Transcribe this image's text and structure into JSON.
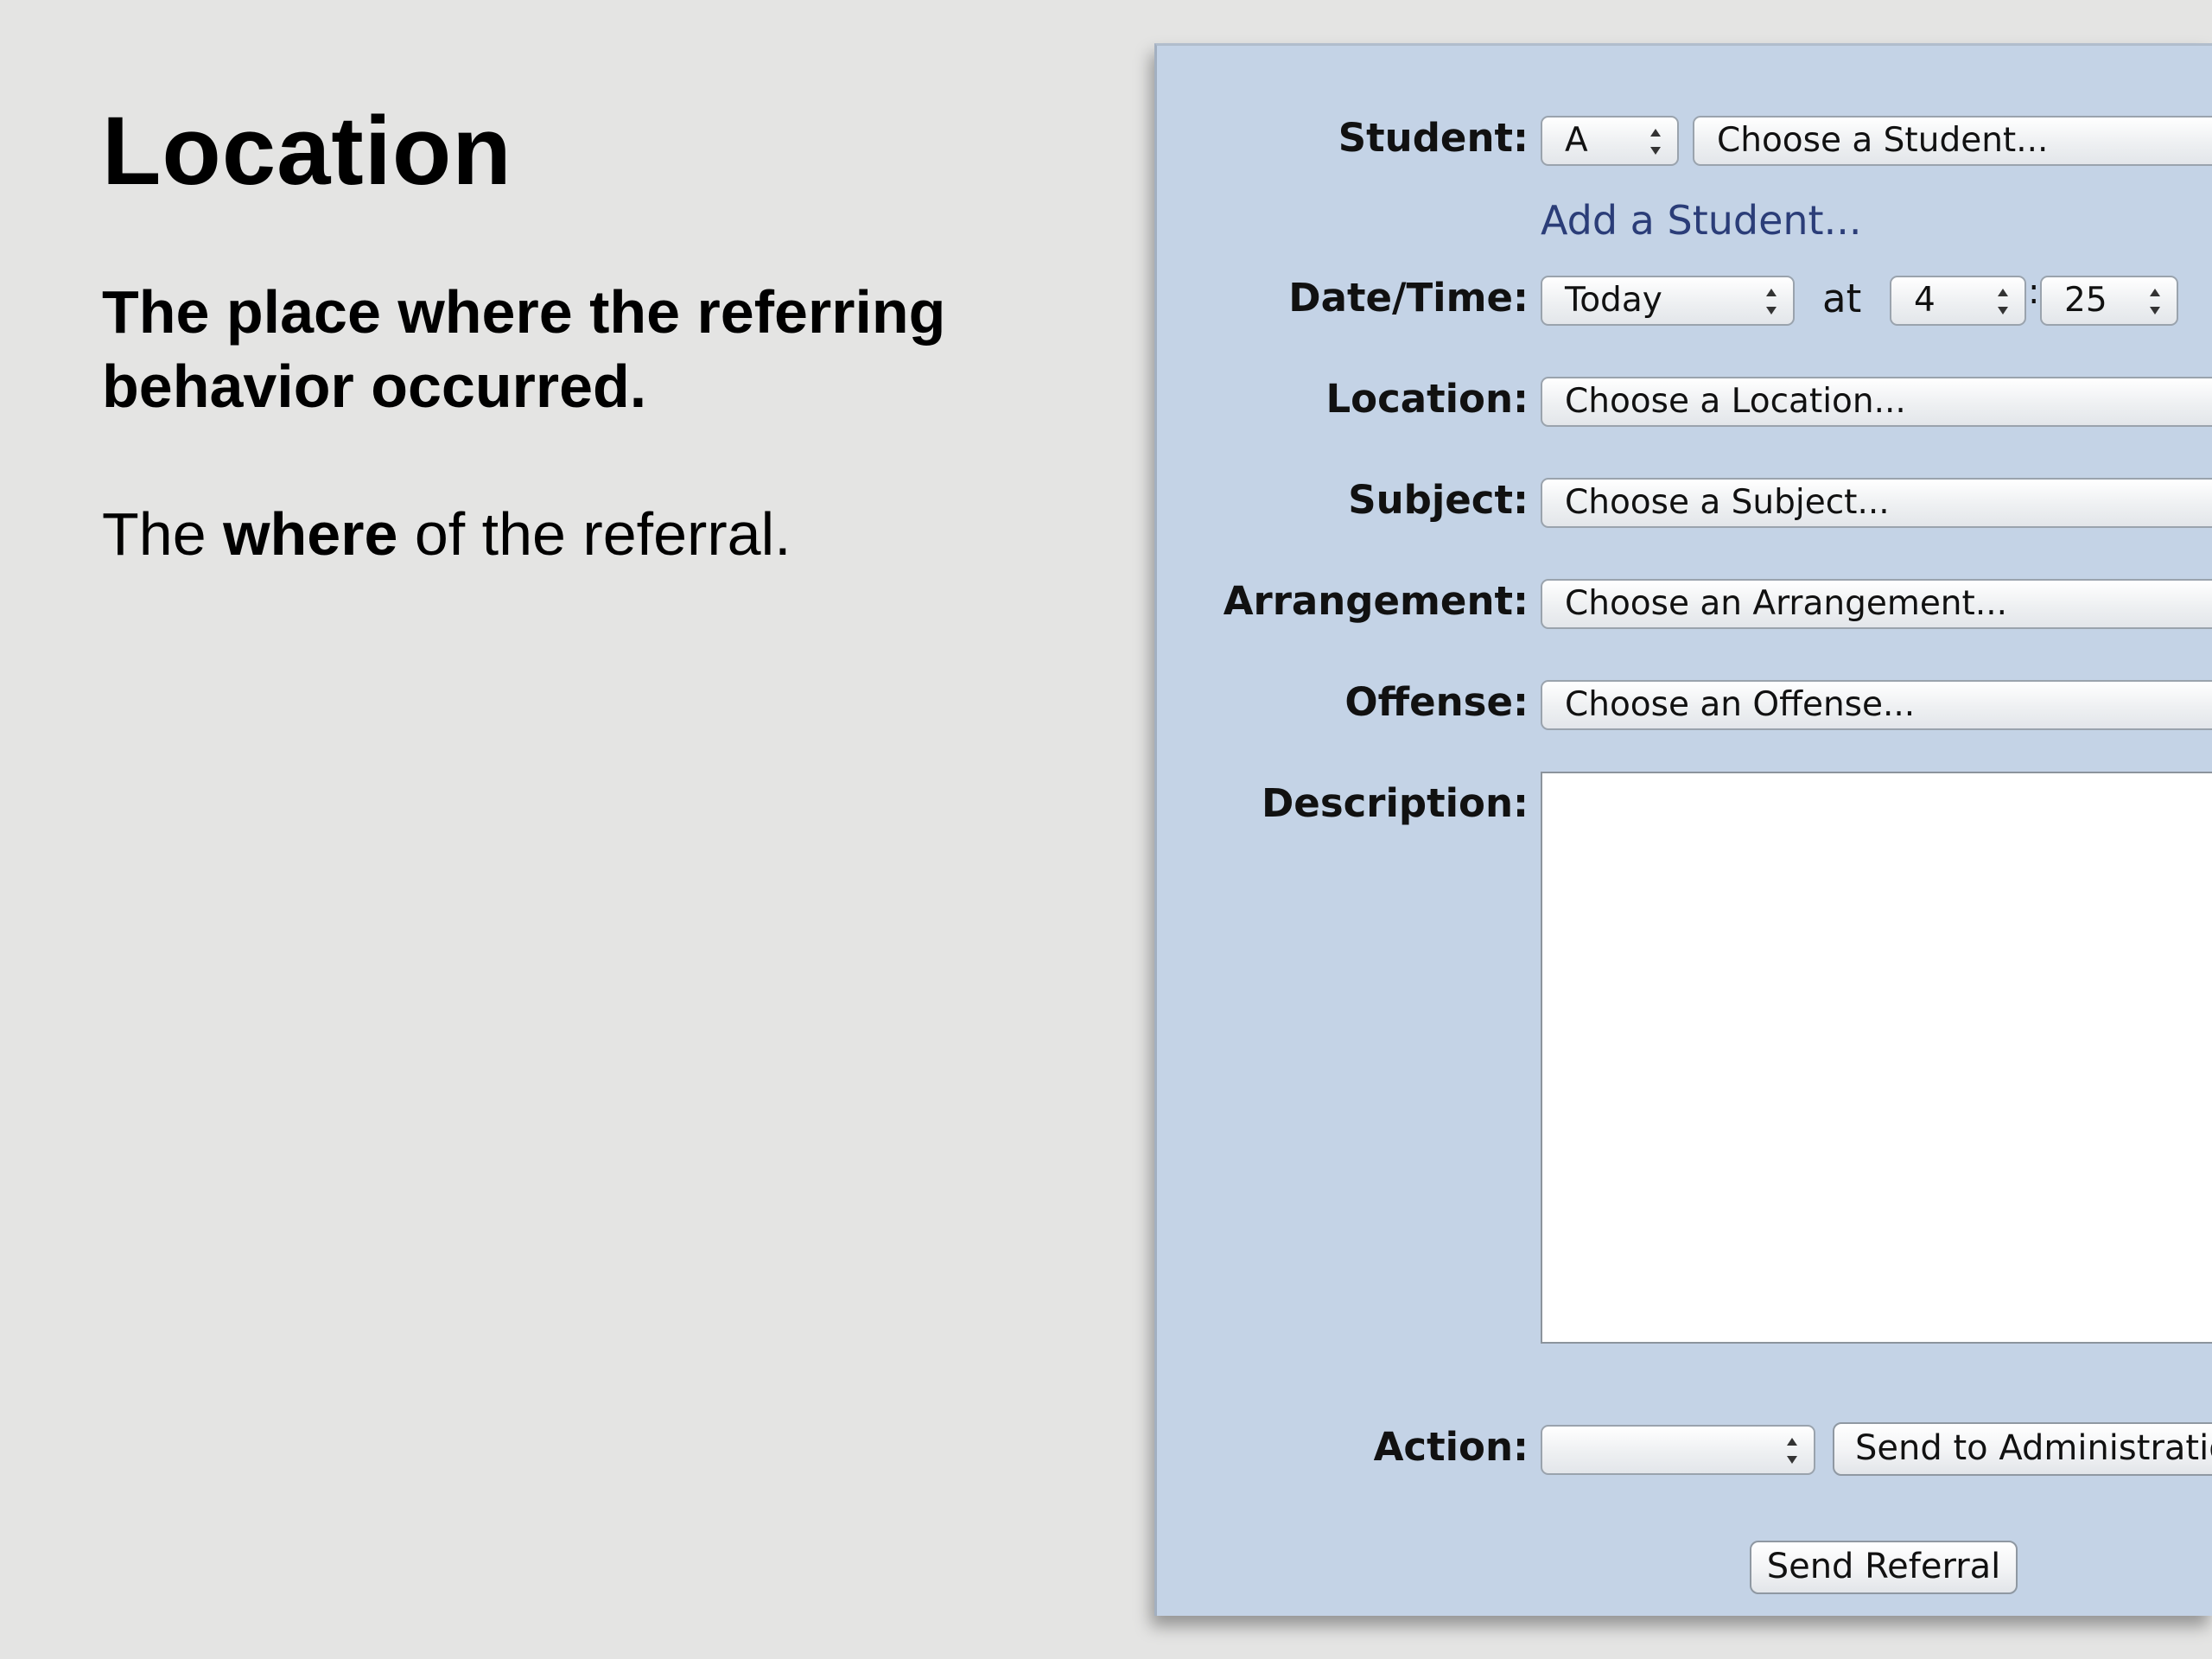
{
  "slide": {
    "title": "Location",
    "subtitle": "The place where the referring behavior occurred.",
    "body_prefix": "The ",
    "body_emphasis": "where",
    "body_suffix": " of the referral."
  },
  "form": {
    "student": {
      "label": "Student:",
      "letter_value": "A",
      "select_placeholder": "Choose a Student...",
      "add_link": "Add a Student..."
    },
    "datetime": {
      "label": "Date/Time:",
      "day_value": "Today",
      "at_text": "at",
      "hour_value": "4",
      "separator": ":",
      "minute_value": "25"
    },
    "location": {
      "label": "Location:",
      "placeholder": "Choose a Location..."
    },
    "subject": {
      "label": "Subject:",
      "placeholder": "Choose a Subject..."
    },
    "arrangement": {
      "label": "Arrangement:",
      "placeholder": "Choose an Arrangement..."
    },
    "offense": {
      "label": "Offense:",
      "placeholder": "Choose an Offense..."
    },
    "description": {
      "label": "Description:",
      "value": ""
    },
    "action": {
      "label": "Action:",
      "value": "",
      "send_admin_button": "Send to Administration"
    },
    "send_button": "Send Referral"
  }
}
